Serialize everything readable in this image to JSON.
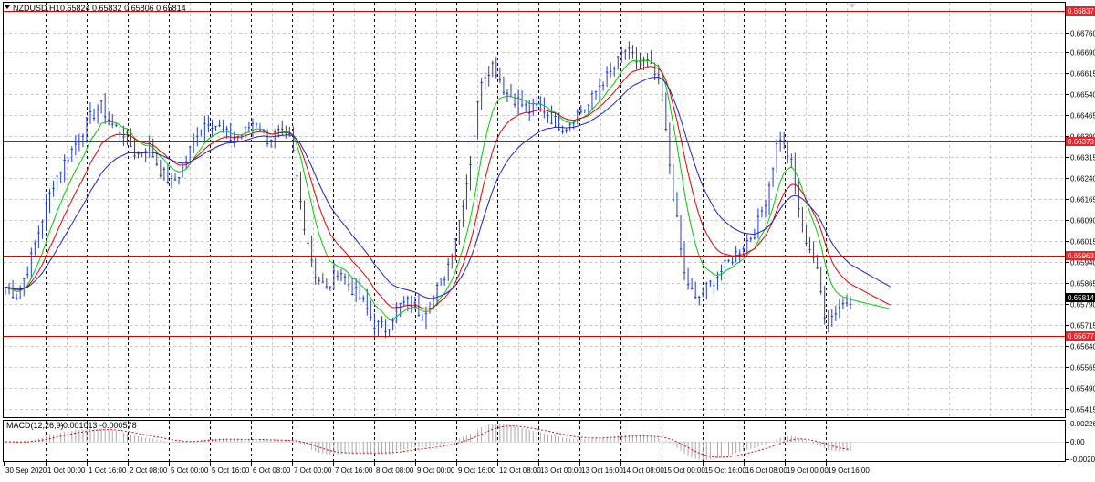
{
  "header": {
    "symbol": "NZDUSD,H1",
    "ohlc": "0.65824 0.65832 0.65806 0.65814"
  },
  "macd_header": {
    "label": "MACD(12,26,9)",
    "values": "-0.001013 -0.000578"
  },
  "colors": {
    "candles": "#1f3cd6",
    "ma_fast": "#00cc00",
    "ma_mid": "#e00000",
    "ma_slow": "#1f1fcf",
    "level_line": "#e00000",
    "badge_red": "#e8262a",
    "badge_black": "#000000",
    "grid": "#c8c8c8",
    "macd_hist": "#a8a8a8",
    "macd_signal": "#e00000"
  },
  "price_axis": {
    "ticks": [
      "0.66760",
      "0.66690",
      "0.66615",
      "0.66540",
      "0.66465",
      "0.66390",
      "0.66315",
      "0.66240",
      "0.66165",
      "0.66090",
      "0.66015",
      "0.65940",
      "0.65865",
      "0.65790",
      "0.65715",
      "0.65640",
      "0.65565",
      "0.65490",
      "0.65415"
    ],
    "range": [
      0.65385,
      0.66868
    ]
  },
  "levels": [
    {
      "price": 0.66837,
      "label": "0.66837"
    },
    {
      "price": 0.66373,
      "label": "0.66373"
    },
    {
      "price": 0.65963,
      "label": "0.65963"
    },
    {
      "price": 0.65677,
      "label": "0.65677"
    }
  ],
  "current_price": {
    "price": 0.65814,
    "label": "0.65814"
  },
  "macd_axis": {
    "ticks": [
      "0.002261",
      "0.00",
      "-0.00208"
    ]
  },
  "time_axis": {
    "labels": [
      "30 Sep 2020",
      "1 Oct 00:00",
      "1 Oct 16:00",
      "2 Oct 08:00",
      "5 Oct 00:00",
      "5 Oct 16:00",
      "6 Oct 08:00",
      "7 Oct 00:00",
      "7 Oct 16:00",
      "8 Oct 08:00",
      "9 Oct 00:00",
      "9 Oct 16:00",
      "12 Oct 08:00",
      "13 Oct 00:00",
      "13 Oct 16:00",
      "14 Oct 08:00",
      "15 Oct 00:00",
      "15 Oct 16:00",
      "16 Oct 08:00",
      "19 Oct 00:00",
      "19 Oct 16:00"
    ]
  },
  "chart_data": {
    "type": "candlestick",
    "symbol": "NZDUSD",
    "timeframe": "H1",
    "price_series": [
      0.6585,
      0.6582,
      0.6593,
      0.6608,
      0.6622,
      0.663,
      0.6637,
      0.6645,
      0.665,
      0.6643,
      0.664,
      0.6632,
      0.6636,
      0.6627,
      0.6622,
      0.6628,
      0.664,
      0.6645,
      0.6642,
      0.6638,
      0.664,
      0.6645,
      0.6638,
      0.664,
      0.6638,
      0.661,
      0.659,
      0.6584,
      0.6592,
      0.6585,
      0.658,
      0.6572,
      0.657,
      0.6578,
      0.658,
      0.6575,
      0.6582,
      0.659,
      0.6606,
      0.6628,
      0.666,
      0.6665,
      0.6655,
      0.6652,
      0.6648,
      0.665,
      0.6645,
      0.6642,
      0.6647,
      0.665,
      0.6658,
      0.6662,
      0.667,
      0.6666,
      0.6665,
      0.6658,
      0.6622,
      0.659,
      0.658,
      0.6585,
      0.659,
      0.6595,
      0.66,
      0.6605,
      0.6618,
      0.664,
      0.663,
      0.6605,
      0.6595,
      0.6572,
      0.6578,
      0.6581
    ]
  }
}
